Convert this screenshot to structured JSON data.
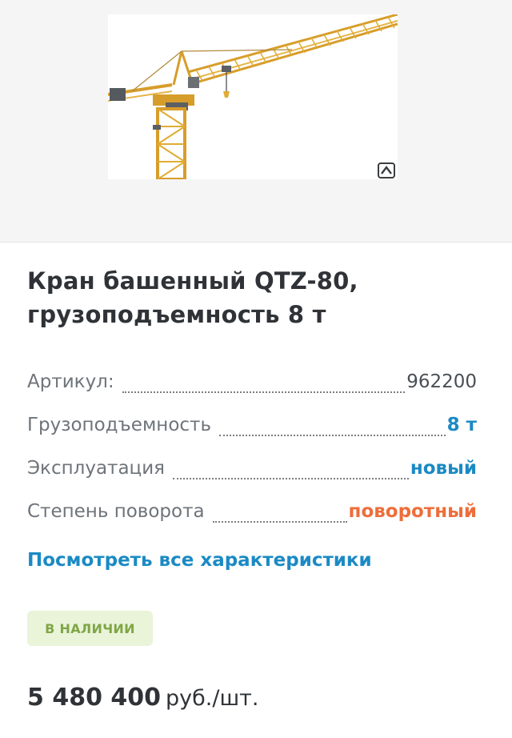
{
  "product": {
    "title": "Кран башенный QTZ-80, грузоподъемность 8 т",
    "image_alt": "Кран башенный QTZ-80"
  },
  "icons": {
    "zoom": "zoom-icon"
  },
  "specs": [
    {
      "label": "Артикул:",
      "value": "962200"
    },
    {
      "label": "Грузоподъемность",
      "value": "8 т"
    },
    {
      "label": "Эксплуатация",
      "value": "новый"
    },
    {
      "label": "Степень поворота",
      "value": "поворотный"
    }
  ],
  "links": {
    "all_specs": "Посмотреть все характеристики"
  },
  "stock": {
    "label": "В НАЛИЧИИ"
  },
  "price": {
    "amount": "5 480 400",
    "unit": "руб./шт."
  },
  "colors": {
    "accent_blue": "#1b8ac4",
    "accent_orange": "#ee6d3a",
    "stock_green": "#7fa646",
    "stock_bg": "#eaf4d9",
    "crane_yellow": "#e0ac34"
  }
}
